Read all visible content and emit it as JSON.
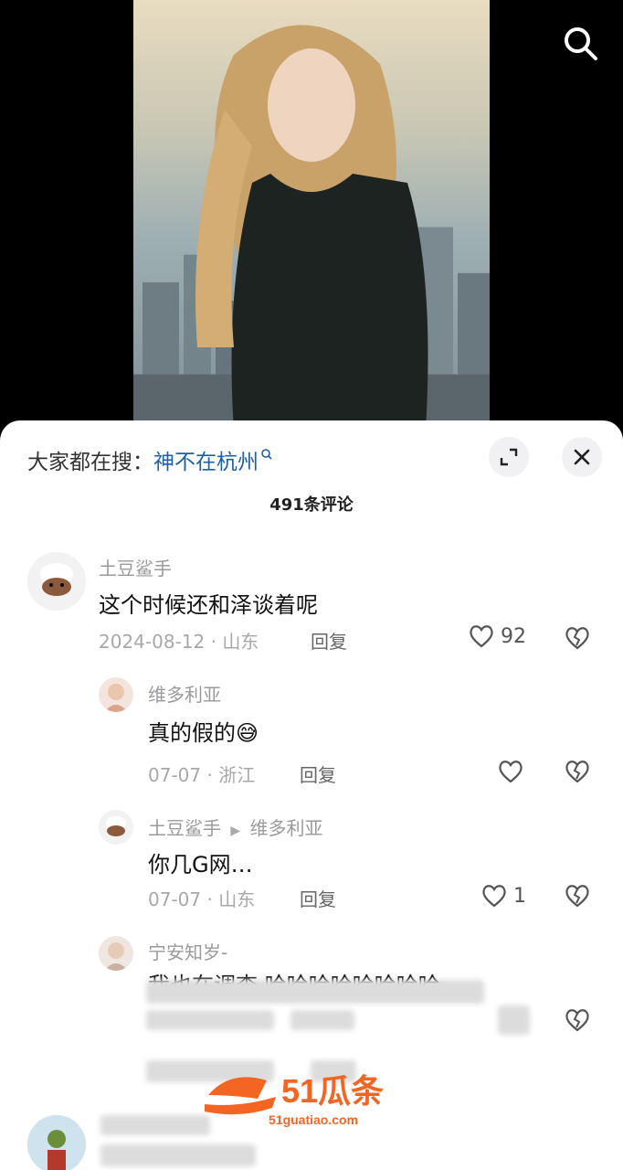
{
  "header": {
    "search_icon": "search-icon"
  },
  "sheet": {
    "trend_label": "大家都在搜：",
    "trend_keyword": "神不在杭州",
    "comment_count": "491条评论"
  },
  "comments": [
    {
      "user": "土豆鲨手",
      "text": "这个时候还和泽谈着呢",
      "date": "2024-08-12",
      "location": "山东",
      "reply": "回复",
      "likes": "92"
    },
    {
      "user": "维多利亚",
      "text": "真的假的😅",
      "date": "07-07",
      "location": "浙江",
      "reply": "回复",
      "likes": ""
    },
    {
      "user": "土豆鲨手",
      "reply_to": "维多利亚",
      "text": "你几G网…",
      "date": "07-07",
      "location": "山东",
      "reply": "回复",
      "likes": "1"
    },
    {
      "user": "宁安知岁-",
      "text": "我也在调查 哈哈哈哈哈哈哈哈"
    }
  ],
  "watermark": {
    "brand": "51瓜条",
    "url": "51guatiao.com"
  },
  "colors": {
    "keyword": "#1f5fa8",
    "watermark": "#f26522"
  }
}
